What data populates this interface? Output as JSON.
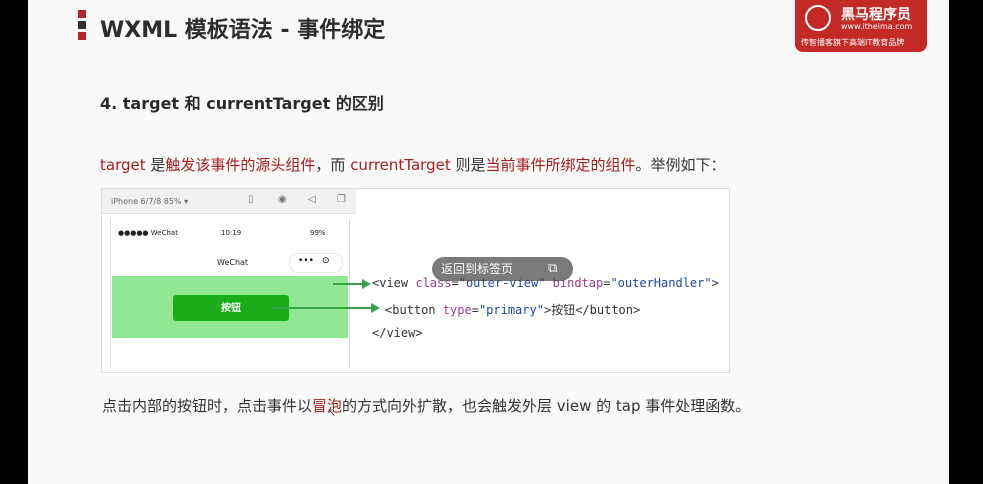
{
  "header": {
    "title": "WXML 模板语法 - 事件绑定",
    "logo_name": "黑马程序员",
    "logo_url": "www.itheima.com",
    "logo_tagline": "传智播客旗下高端IT教育品牌"
  },
  "section": {
    "subtitle": "4. target 和 currentTarget 的区别",
    "desc": [
      {
        "text": "target",
        "red": true
      },
      {
        "text": " 是",
        "red": false
      },
      {
        "text": "触发该事件的源头组件",
        "red": true
      },
      {
        "text": "，而 ",
        "red": false
      },
      {
        "text": "currentTarget",
        "red": true
      },
      {
        "text": " 则是",
        "red": false
      },
      {
        "text": "当前事件所绑定的组件",
        "red": true
      },
      {
        "text": "。举例如下：",
        "red": false
      }
    ]
  },
  "screenshot": {
    "device": "iPhone 6/7/8 85% ▾",
    "status_left": "●●●●● WeChat",
    "status_time": "10:19",
    "status_battery": "99%",
    "nav_title": "WeChat",
    "capsule_dots": "•••",
    "capsule_target": "⊙",
    "button_label": "按钮"
  },
  "code_lines": {
    "line1": [
      {
        "t": "<view ",
        "c": ""
      },
      {
        "t": "class",
        "c": "a"
      },
      {
        "t": "=",
        "c": ""
      },
      {
        "t": "\"outer-view\"",
        "c": "v"
      },
      {
        "t": " bindtap",
        "c": "a"
      },
      {
        "t": "=",
        "c": ""
      },
      {
        "t": "\"outerHandler\"",
        "c": "v"
      },
      {
        "t": ">",
        "c": ""
      }
    ],
    "line2": [
      {
        "t": "<button ",
        "c": ""
      },
      {
        "t": "type",
        "c": "a"
      },
      {
        "t": "=",
        "c": ""
      },
      {
        "t": "\"primary\"",
        "c": "v"
      },
      {
        "t": ">按钮</button>",
        "c": ""
      }
    ],
    "line3": [
      {
        "t": "</view>",
        "c": ""
      }
    ]
  },
  "toast": {
    "label": "返回到标签页",
    "icon": "external-link-icon"
  },
  "footer": {
    "before": "点击内部的按钮时，点击事件以",
    "highlight": "冒泡",
    "after": "的方式向外扩散，也会触发外层 view 的 tap 事件处理函数。"
  },
  "colors": {
    "accent_red": "#a71f1c",
    "outer_view_green": "#92e892",
    "button_green": "#1aad19",
    "arrow_green": "#36a24a"
  }
}
